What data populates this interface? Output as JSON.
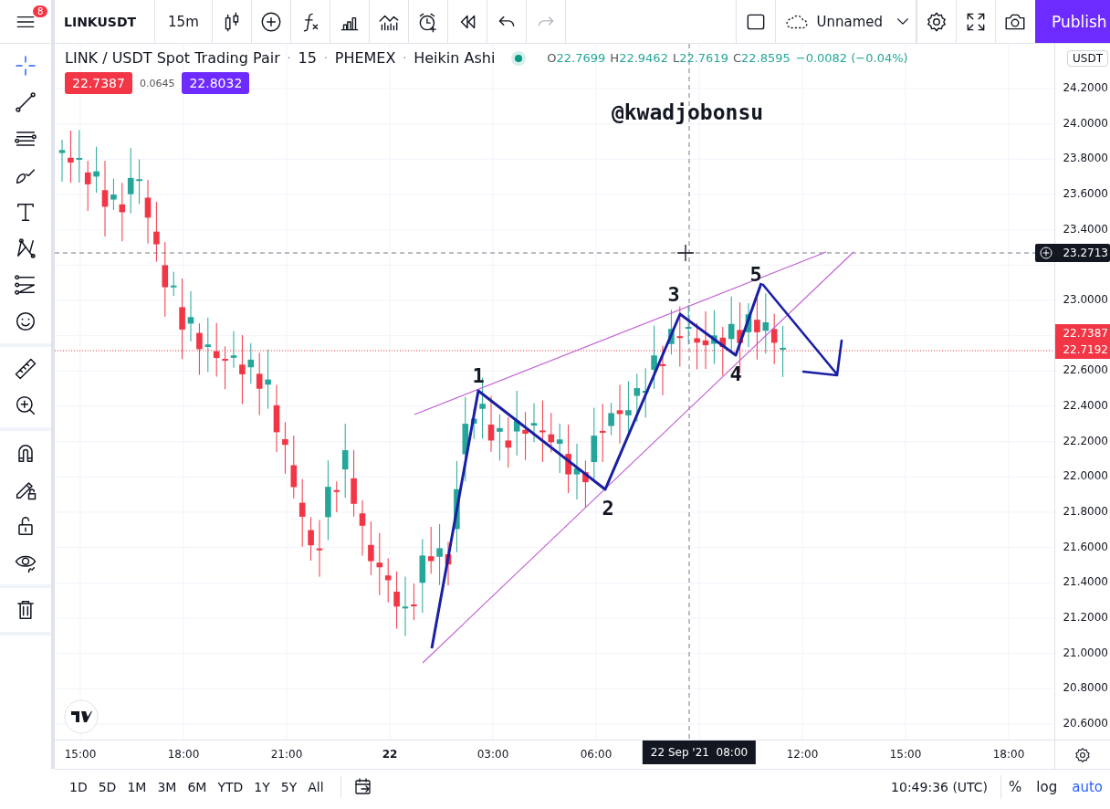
{
  "top_toolbar": {
    "notification_count": "8",
    "symbol": "LINKUSDT",
    "interval": "15m",
    "layout_name": "Unnamed",
    "publish": "Publish"
  },
  "legend": {
    "title_parts": [
      "LINK / USDT Spot Trading Pair",
      "15",
      "PHEMEX",
      "Heikin Ashi"
    ],
    "separator": "·",
    "ohlc": [
      {
        "label": "O",
        "value": "22.7699"
      },
      {
        "label": "H",
        "value": "22.9462"
      },
      {
        "label": "L",
        "value": "22.7619"
      },
      {
        "label": "C",
        "value": "22.8595"
      }
    ],
    "change": "−0.0082 (−0.04%)",
    "quote": [
      {
        "kind": "sell",
        "text": "22.7387"
      },
      {
        "kind": "spread",
        "text": "0.0645"
      },
      {
        "kind": "buy",
        "text": "22.8032"
      }
    ]
  },
  "chart": {
    "watermark_text": "@kwadjobonsu",
    "wave_labels": [
      "1",
      "2",
      "3",
      "4",
      "5"
    ]
  },
  "price_axis": {
    "currency": "USDT",
    "ticks": [
      {
        "kind": "price",
        "text": "24.2000"
      },
      {
        "kind": "price",
        "text": "24.0000"
      },
      {
        "kind": "price",
        "text": "23.8000"
      },
      {
        "kind": "price",
        "text": "23.6000"
      },
      {
        "kind": "price",
        "text": "23.4000"
      },
      {
        "kind": "crosshair",
        "text": "23.2713"
      },
      {
        "kind": "price",
        "text": "23.0000"
      },
      {
        "kind": "last",
        "texts": [
          "22.7387",
          "22.7192"
        ]
      },
      {
        "kind": "price",
        "text": "22.6000"
      },
      {
        "kind": "price",
        "text": "22.4000"
      },
      {
        "kind": "price",
        "text": "22.2000"
      },
      {
        "kind": "price",
        "text": "22.0000"
      },
      {
        "kind": "price",
        "text": "21.8000"
      },
      {
        "kind": "price",
        "text": "21.6000"
      },
      {
        "kind": "price",
        "text": "21.4000"
      },
      {
        "kind": "price",
        "text": "21.2000"
      },
      {
        "kind": "price",
        "text": "21.0000"
      },
      {
        "kind": "price",
        "text": "20.8000"
      },
      {
        "kind": "price",
        "text": "20.6000"
      }
    ]
  },
  "time_axis": {
    "ticks": [
      {
        "kind": "time",
        "text": "15:00"
      },
      {
        "kind": "time",
        "text": "18:00"
      },
      {
        "kind": "time",
        "text": "21:00"
      },
      {
        "kind": "day",
        "text": "22"
      },
      {
        "kind": "time",
        "text": "03:00"
      },
      {
        "kind": "time",
        "text": "06:00"
      },
      {
        "kind": "crosshair",
        "text": "22 Sep '21  08:00"
      },
      {
        "kind": "time",
        "text": "12:00"
      },
      {
        "kind": "time",
        "text": "15:00"
      },
      {
        "kind": "time",
        "text": "18:00"
      }
    ]
  },
  "bottom_bar": {
    "ranges": [
      "1D",
      "5D",
      "1M",
      "3M",
      "6M",
      "YTD",
      "1Y",
      "5Y",
      "All"
    ],
    "clock": "10:49:36 (UTC)",
    "toggles": [
      {
        "text": "%",
        "on": false
      },
      {
        "text": "log",
        "on": false
      },
      {
        "text": "auto",
        "on": true
      }
    ]
  }
}
